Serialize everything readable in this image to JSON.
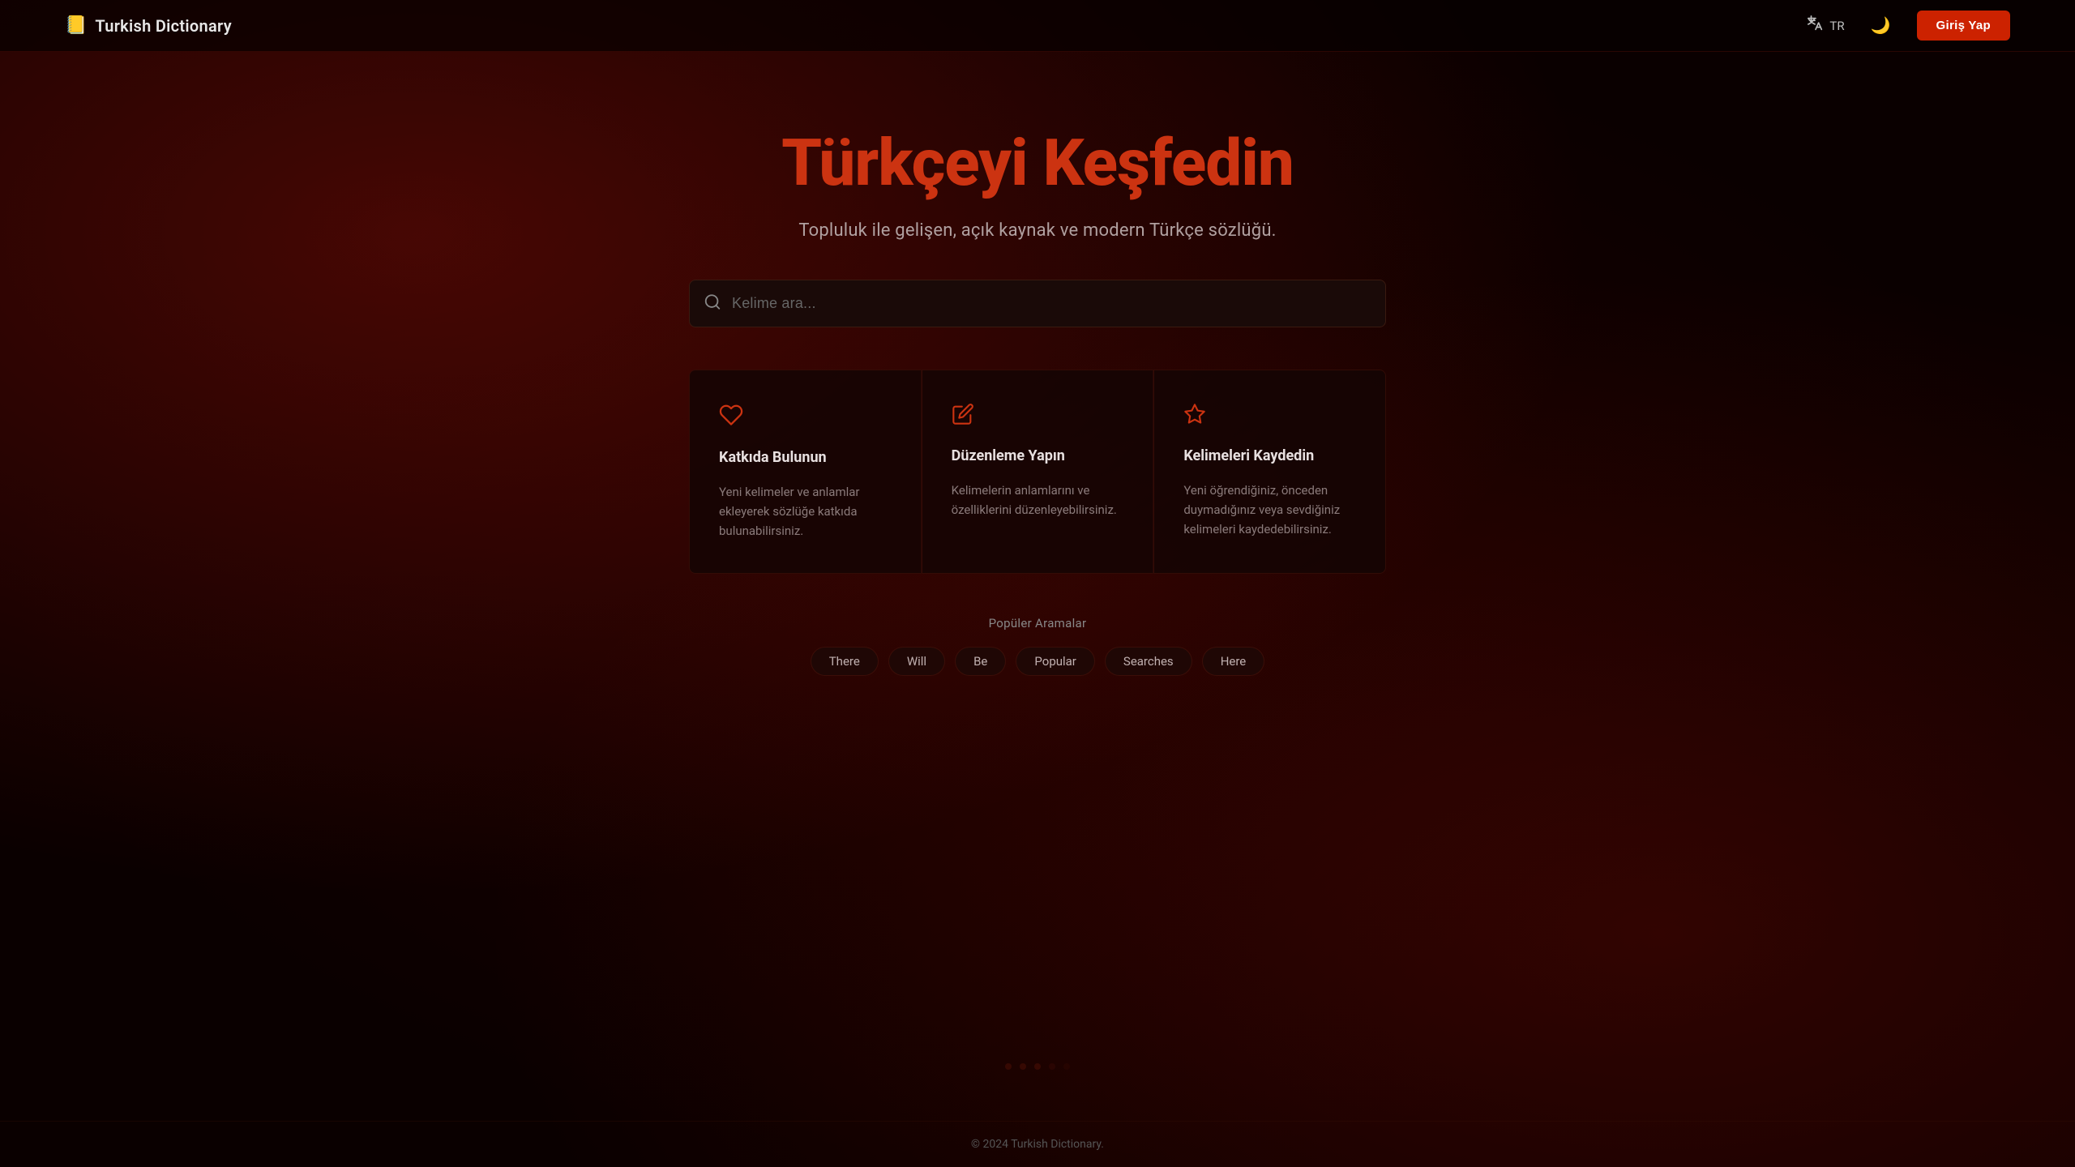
{
  "navbar": {
    "brand_icon": "📖",
    "brand_text": "Turkish Dictionary",
    "lang_label": "TR",
    "theme_icon": "🌙",
    "login_label": "Giriş Yap"
  },
  "hero": {
    "title": "Türkçeyi Keşfedin",
    "subtitle": "Topluluk ile gelişen, açık kaynak ve modern Türkçe sözlüğü."
  },
  "search": {
    "placeholder": "Kelime ara..."
  },
  "cards": [
    {
      "icon": "♥",
      "title": "Katkıda Bulunun",
      "desc": "Yeni kelimeler ve anlamlar ekleyerek sözlüğe katkıda bulunabilirsiniz."
    },
    {
      "icon": "✏",
      "title": "Düzenleme Yapın",
      "desc": "Kelimelerin anlamlarını ve özelliklerini düzenleyebilirsiniz."
    },
    {
      "icon": "✦",
      "title": "Kelimeleri Kaydedin",
      "desc": "Yeni öğrendiğiniz, önceden duymadığınız veya sevdiğiniz kelimeleri kaydedebilirsiniz."
    }
  ],
  "popular": {
    "label": "Popüler Aramalar",
    "tags": [
      "There",
      "Will",
      "Be",
      "Popular",
      "Searches",
      "Here"
    ]
  },
  "footer": {
    "text": "© 2024 Turkish Dictionary."
  }
}
